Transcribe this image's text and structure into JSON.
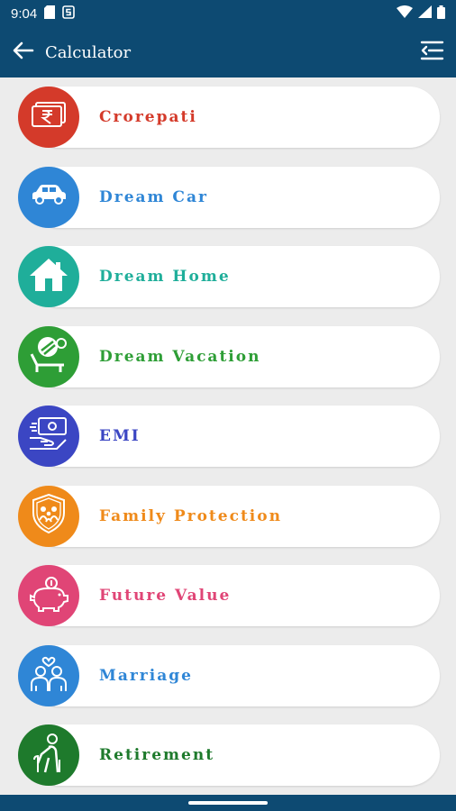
{
  "status_bar": {
    "time": "9:04",
    "icons_left": [
      "sd-card-icon",
      "s-app-icon"
    ],
    "icons_right": [
      "wifi-icon",
      "signal-icon",
      "battery-icon"
    ]
  },
  "app_bar": {
    "title": "Calculator",
    "back_icon": "arrow-left-icon",
    "menu_icon": "menu-icon"
  },
  "calculators": [
    {
      "label": "Crorepati",
      "color": "#d43a2a",
      "icon": "rupee-notes-icon"
    },
    {
      "label": "Dream Car",
      "color": "#2f86d6",
      "icon": "car-icon"
    },
    {
      "label": "Dream Home",
      "color": "#1fae9a",
      "icon": "house-icon"
    },
    {
      "label": "Dream Vacation",
      "color": "#2e9e36",
      "icon": "beach-chair-icon"
    },
    {
      "label": "EMI",
      "color": "#3b46c3",
      "icon": "money-hand-icon"
    },
    {
      "label": "Family Protection",
      "color": "#ef8a1a",
      "icon": "family-shield-icon"
    },
    {
      "label": "Future Value",
      "color": "#e04576",
      "icon": "piggy-bank-icon"
    },
    {
      "label": "Marriage",
      "color": "#2f86d6",
      "icon": "couple-icon"
    },
    {
      "label": "Retirement",
      "color": "#1e7a2c",
      "icon": "elderly-cane-icon"
    }
  ]
}
